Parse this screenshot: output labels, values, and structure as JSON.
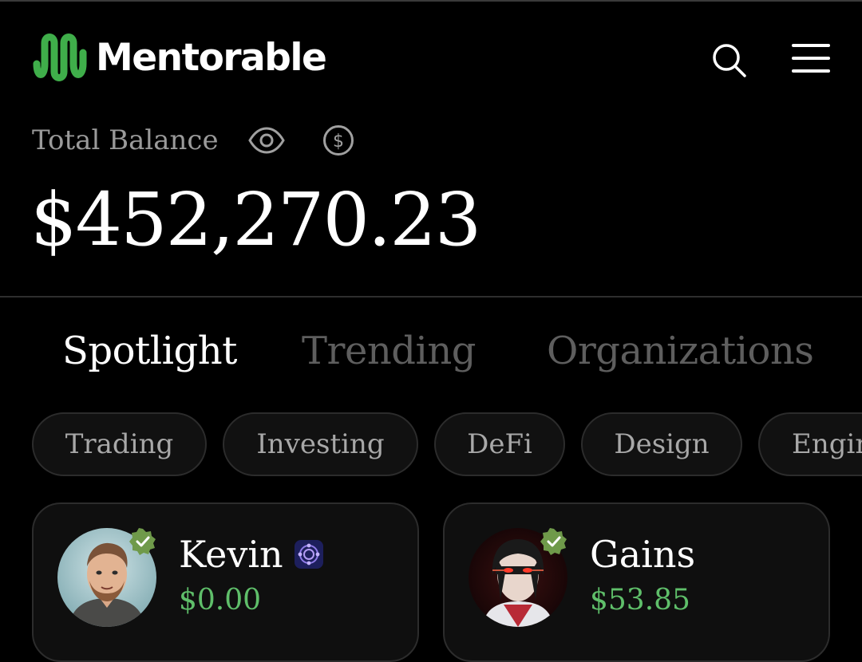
{
  "header": {
    "brand": "Mentorable",
    "logo_icon": "mentorable-logo-icon",
    "accent_color": "#3fae4a"
  },
  "balance": {
    "label": "Total Balance",
    "value": "$452,270.23"
  },
  "tabs": [
    {
      "label": "Spotlight",
      "active": true
    },
    {
      "label": "Trending",
      "active": false
    },
    {
      "label": "Organizations",
      "active": false
    }
  ],
  "chips": [
    {
      "label": "Trading"
    },
    {
      "label": "Investing"
    },
    {
      "label": "DeFi"
    },
    {
      "label": "Design"
    },
    {
      "label": "Engin"
    }
  ],
  "cards": [
    {
      "name": "Kevin",
      "amount": "$0.00",
      "verified": true,
      "badge": "organization-badge-icon"
    },
    {
      "name": "Gains",
      "amount": "$53.85",
      "verified": true
    }
  ],
  "colors": {
    "positive_amount": "#5fbf6a",
    "verified_badge": "#6f9a4a",
    "inactive_tab": "#5e5e5e"
  }
}
